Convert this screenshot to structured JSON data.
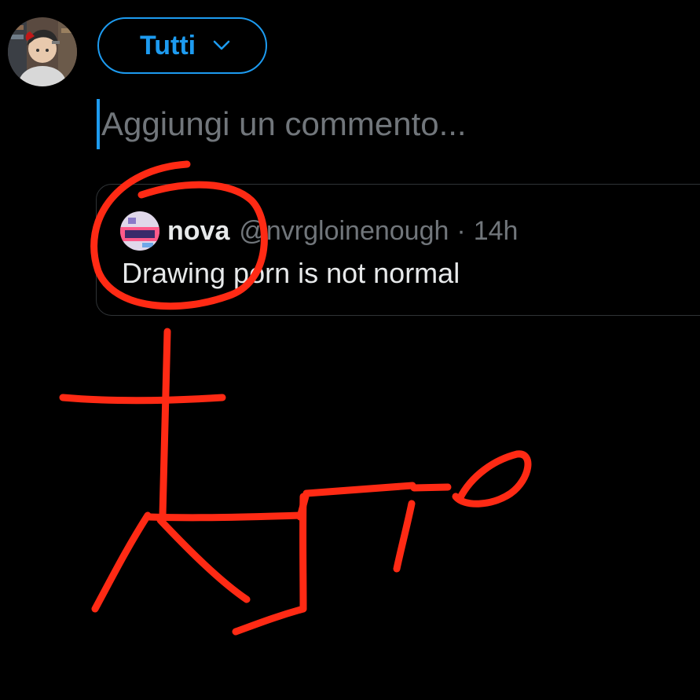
{
  "composer": {
    "audience_label": "Tutti",
    "placeholder": "Aggiungi un commento..."
  },
  "quoted_tweet": {
    "name": "nova",
    "handle": "@nvrgloinenough",
    "separator": "·",
    "time": "14h",
    "text": "Drawing porn is not normal"
  },
  "icons": {
    "audience_chevron": "chevron-down-icon"
  },
  "colors": {
    "background": "#000000",
    "accent": "#1d9bf0",
    "secondary_text": "#71767b",
    "primary_text": "#e7e9ea",
    "card_border": "#2f3336",
    "scribble": "#ff2a14"
  }
}
